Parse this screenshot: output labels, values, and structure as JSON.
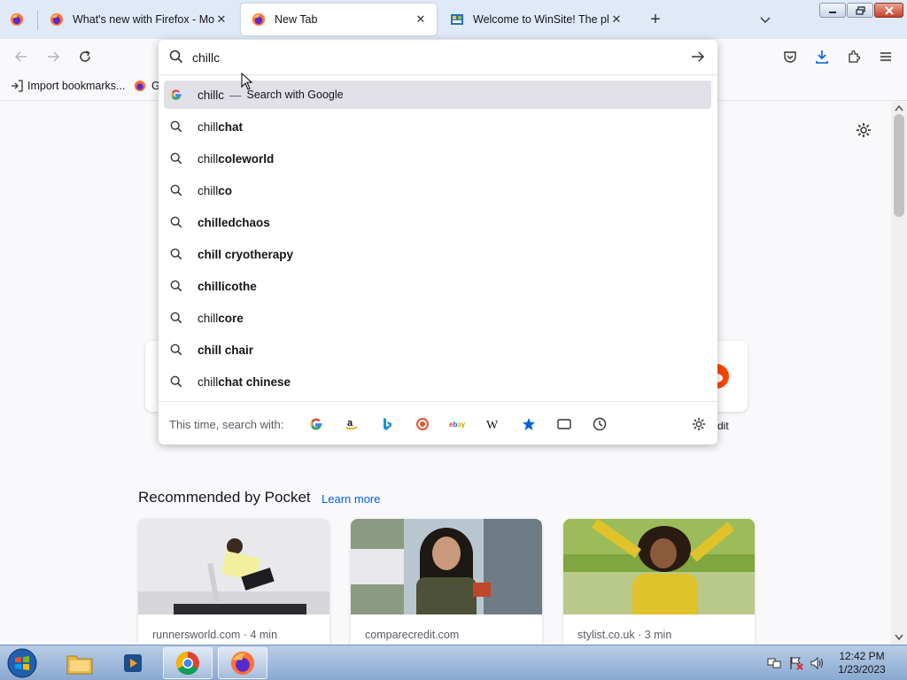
{
  "browser": {
    "tabs": [
      {
        "title": "What's new with Firefox - More",
        "active": false,
        "icon": "firefox-icon"
      },
      {
        "title": "New Tab",
        "active": true,
        "icon": "firefox-icon"
      },
      {
        "title": "Welcome to WinSite! The place",
        "active": false,
        "icon": "winsite-icon"
      }
    ],
    "new_tab_symbol": "+",
    "close_symbol": "✕"
  },
  "urlbar": {
    "value": "chillc",
    "suggestions": [
      {
        "typed": "chillc",
        "rest": "",
        "action": "Search with Google",
        "selected": true,
        "kind": "engine"
      },
      {
        "typed": "chill",
        "rest": "chat",
        "selected": false,
        "kind": "search"
      },
      {
        "typed": "chill",
        "rest": "coleworld",
        "selected": false,
        "kind": "search"
      },
      {
        "typed": "chill",
        "rest": "co",
        "selected": false,
        "kind": "search"
      },
      {
        "typed": "",
        "rest": "chilledchaos",
        "selected": false,
        "kind": "search"
      },
      {
        "typed": "",
        "rest": "chill cryotherapy",
        "selected": false,
        "kind": "search"
      },
      {
        "typed": "",
        "rest": "chillicothe",
        "selected": false,
        "kind": "search"
      },
      {
        "typed": "chill",
        "rest": "core",
        "selected": false,
        "kind": "search"
      },
      {
        "typed": "",
        "rest": "chill chair",
        "selected": false,
        "kind": "search"
      },
      {
        "typed": "chill",
        "rest": "chat chinese",
        "selected": false,
        "kind": "search"
      }
    ],
    "separator": "—",
    "oneoff_label": "This time, search with:",
    "engines": [
      "google-icon",
      "amazon-icon",
      "bing-icon",
      "duckduckgo-icon",
      "ebay-icon",
      "wikipedia-icon",
      "bookmarks-icon",
      "tabs-icon",
      "history-icon"
    ]
  },
  "bookmarks": {
    "import_label": "Import bookmarks...",
    "second_label": "G"
  },
  "newtab": {
    "shortcut_partial_label": "dit",
    "pocket_heading": "Recommended by Pocket",
    "learn_more": "Learn more",
    "cards": [
      {
        "source": "runnersworld.com · 4 min"
      },
      {
        "source": "comparecredit.com"
      },
      {
        "source": "stylist.co.uk · 3 min"
      }
    ]
  },
  "taskbar": {
    "time": "12:42 PM",
    "date": "1/23/2023"
  },
  "colors": {
    "accent": "#0061e0",
    "tabstrip": "#dfe9f7",
    "selected_row": "#e0e0e6"
  }
}
